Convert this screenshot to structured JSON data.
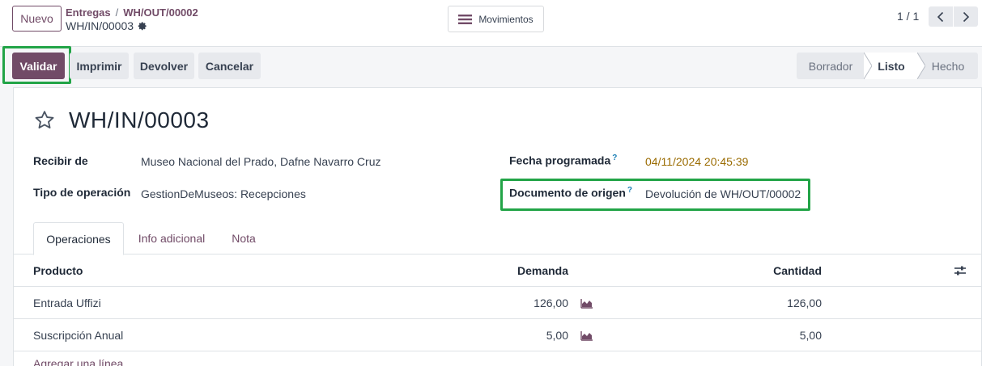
{
  "topbar": {
    "new_button": "Nuevo",
    "breadcrumb": [
      {
        "label": "Entregas"
      },
      {
        "label": "WH/OUT/00002"
      }
    ],
    "breadcrumb_separator": "/",
    "record_name": "WH/IN/00003",
    "moves_button": "Movimientos",
    "pager": "1 / 1"
  },
  "actions": {
    "validate": "Validar",
    "print": "Imprimir",
    "return": "Devolver",
    "cancel": "Cancelar"
  },
  "status": {
    "stages": [
      "Borrador",
      "Listo",
      "Hecho"
    ],
    "current": "Listo"
  },
  "form": {
    "title": "WH/IN/00003",
    "receive_from_label": "Recibir de",
    "receive_from_value": "Museo Nacional del Prado, Dafne Navarro Cruz",
    "operation_type_label": "Tipo de operación",
    "operation_type_value": "GestionDeMuseos: Recepciones",
    "scheduled_date_label": "Fecha programada",
    "scheduled_date_value": "04/11/2024 20:45:39",
    "source_doc_label": "Documento de origen",
    "source_doc_value": "Devolución de WH/OUT/00002",
    "help_mark": "?"
  },
  "tabs": [
    {
      "label": "Operaciones",
      "active": true
    },
    {
      "label": "Info adicional",
      "active": false
    },
    {
      "label": "Nota",
      "active": false
    }
  ],
  "table": {
    "columns": {
      "product": "Producto",
      "demand": "Demanda",
      "quantity": "Cantidad"
    },
    "rows": [
      {
        "product": "Entrada Uffizi",
        "demand": "126,00",
        "quantity": "126,00"
      },
      {
        "product": "Suscripción Anual",
        "demand": "5,00",
        "quantity": "5,00"
      }
    ],
    "add_line": "Agregar una línea"
  },
  "colors": {
    "brand": "#714b67",
    "highlight": "#22a447",
    "date": "#9a6b00",
    "help": "#1a7fb5"
  },
  "icons": [
    "gear-icon",
    "menu-icon",
    "chevron-left-icon",
    "chevron-right-icon",
    "star-icon",
    "forecast-chart-icon",
    "column-settings-icon"
  ]
}
